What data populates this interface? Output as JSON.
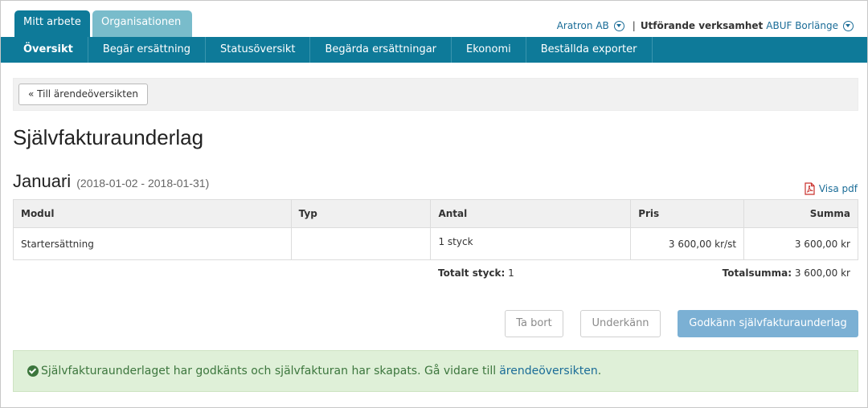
{
  "tabs": {
    "active": "Mitt arbete",
    "inactive": "Organisationen"
  },
  "account": {
    "company": "Aratron AB",
    "separator": "|",
    "label": "Utförande verksamhet",
    "value": "ABUF Borlänge"
  },
  "nav": {
    "items": [
      {
        "label": "Översikt"
      },
      {
        "label": "Begär ersättning"
      },
      {
        "label": "Statusöversikt"
      },
      {
        "label": "Begärda ersättningar"
      },
      {
        "label": "Ekonomi"
      },
      {
        "label": "Beställda exporter"
      }
    ]
  },
  "back_button": "« Till ärendeöversikten",
  "page_title": "Självfakturaunderlag",
  "period": {
    "month": "Januari",
    "range": "(2018-01-02 - 2018-01-31)"
  },
  "pdf_link": "Visa pdf",
  "table": {
    "headers": [
      "Modul",
      "Typ",
      "Antal",
      "Pris",
      "Summa"
    ],
    "rows": [
      {
        "modul": "Startersättning",
        "typ": "",
        "antal": "1 styck",
        "pris": "3 600,00 kr/st",
        "summa": "3 600,00 kr"
      }
    ]
  },
  "totals": {
    "count_label": "Totalt styck:",
    "count_value": "1",
    "sum_label": "Totalsumma:",
    "sum_value": "3 600,00 kr"
  },
  "buttons": {
    "remove": "Ta bort",
    "reject": "Underkänn",
    "approve": "Godkänn självfakturaunderlag"
  },
  "alert": {
    "message": "Självfakturaunderlaget har godkänts och självfakturan har skapats. Gå vidare till",
    "link": "ärendeöversikten",
    "suffix": "."
  },
  "colors": {
    "primary": "#0e7a99",
    "inactive_tab": "#79bccb",
    "link": "#1a6c97",
    "approve_button": "#7bb0d4",
    "alert_bg": "#dff0d8",
    "alert_text": "#3c763d"
  },
  "icons": [
    "chevron-down-circle-icon",
    "pdf-icon",
    "check-circle-icon"
  ]
}
